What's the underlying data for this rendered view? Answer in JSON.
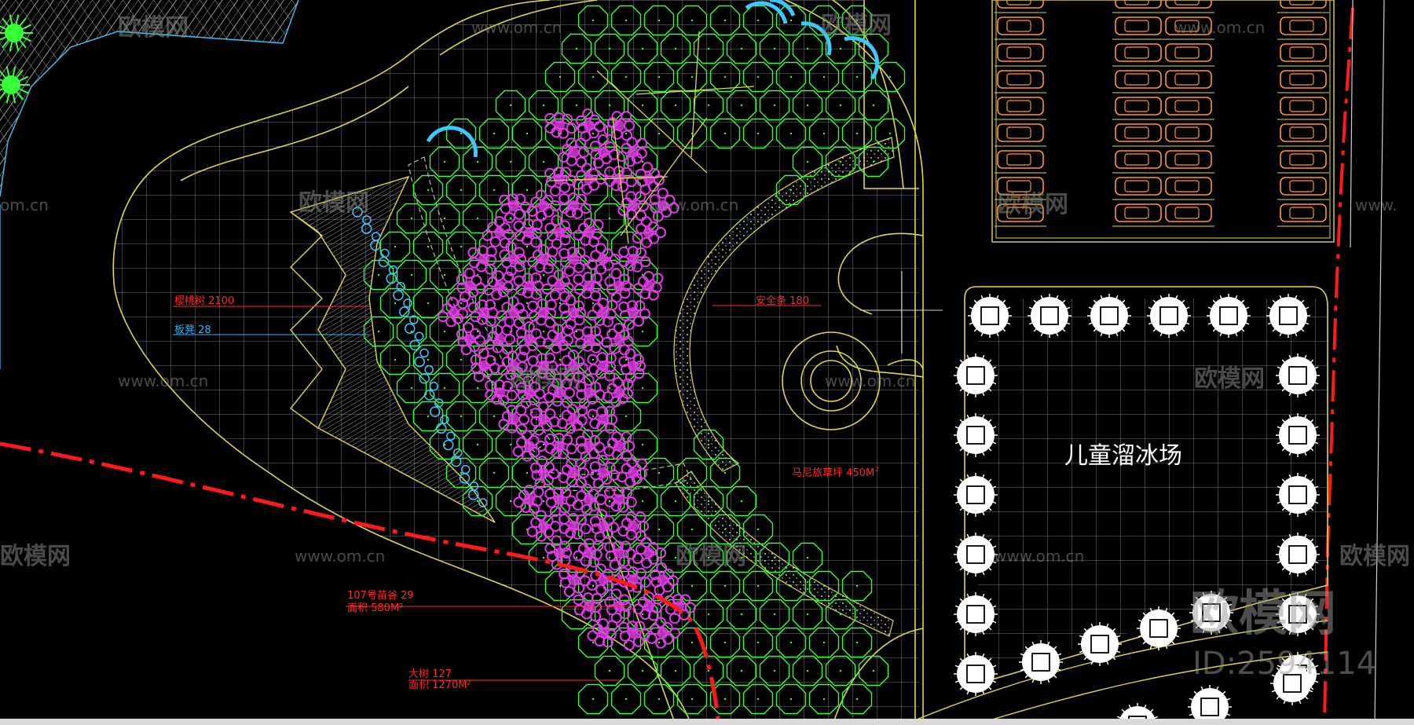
{
  "colors": {
    "background": "#000000",
    "outline": "#e0d84a",
    "grid": "#9a9a9a",
    "tree_green": "#36ff36",
    "flower_magenta": "#e23ce6",
    "highlight_cyan": "#3fc6ff",
    "car_orange": "#ff9a1a",
    "boundary_red": "#ff1a1a",
    "label_red": "#ff2a2a",
    "label_cyan": "#2fb6ff"
  },
  "labels": {
    "hedge": "樱桃树 2100",
    "board": "板凳 28",
    "safety_strip": "安全条 180",
    "horseshoe_area": "马尼旅草坪 450M",
    "horseshoe_sup": "2",
    "shrub1_line1": "107号苗谷 29",
    "shrub1_line2": "面积 580M²",
    "shrub2_line1": "大树 127",
    "shrub2_line2": "面积 1270M²",
    "rink": "儿童溜冰场"
  },
  "watermarks": {
    "brand": "欧模网",
    "brand_short": "欧模网",
    "url": "www.om.cn",
    "url_short": "om.cn",
    "url_cut": "www.",
    "id": "ID:2594114"
  },
  "icons": {
    "tree": "tree-symbol-icon",
    "flower": "flower-shrub-icon",
    "car": "car-parking-icon",
    "palm": "round-tree-icon"
  }
}
